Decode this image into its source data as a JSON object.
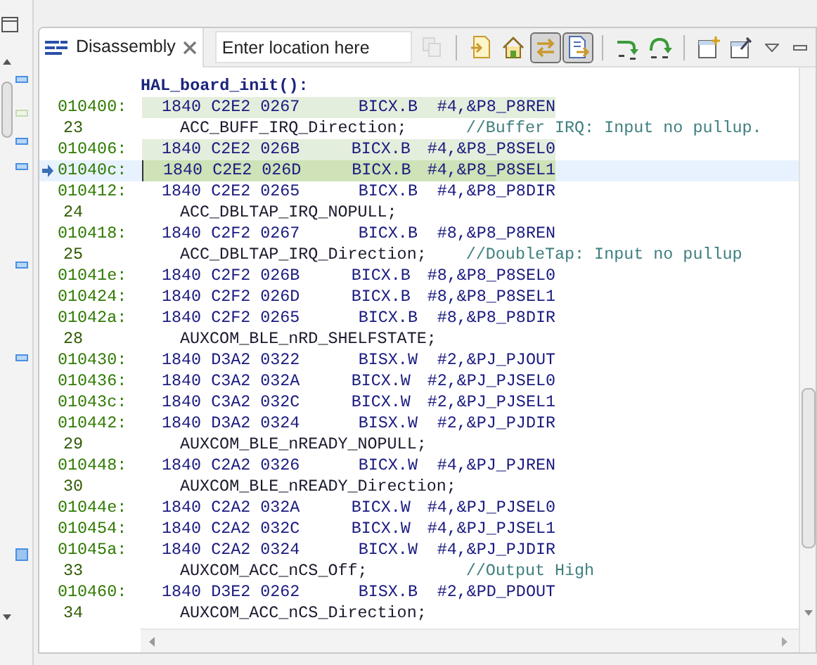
{
  "tab": {
    "label": "Disassembly",
    "selected": true
  },
  "location_field": {
    "placeholder": "Enter location here"
  },
  "toolbar": [
    {
      "kind": "go",
      "pressed": false,
      "disabled": true
    },
    {
      "kind": "separator"
    },
    {
      "kind": "pc",
      "pressed": false,
      "disabled": false
    },
    {
      "kind": "home",
      "pressed": false,
      "disabled": false
    },
    {
      "kind": "link",
      "pressed": true,
      "disabled": false
    },
    {
      "kind": "sync",
      "pressed": true,
      "disabled": false
    },
    {
      "kind": "separator"
    },
    {
      "kind": "step-into",
      "pressed": false,
      "disabled": false
    },
    {
      "kind": "step-over",
      "pressed": false,
      "disabled": false
    },
    {
      "kind": "separator"
    },
    {
      "kind": "new-view",
      "pressed": false,
      "disabled": false
    },
    {
      "kind": "pin",
      "pressed": false,
      "disabled": false
    }
  ],
  "function_label": "HAL_board_init():",
  "rows": [
    {
      "kind": "asm",
      "address": "010400:",
      "bytes": "1840 C2E2 0267",
      "mnemonic": "BICX.B",
      "operands": "#4,&P8_P8REN",
      "highlighted": true,
      "current": false
    },
    {
      "kind": "src",
      "line": "23",
      "code": "ACC_BUFF_IRQ_Direction;",
      "comment": "//Buffer IRQ:  Input no pullup."
    },
    {
      "kind": "asm",
      "address": "010406:",
      "bytes": "1840 C2E2 026B",
      "mnemonic": "BICX.B",
      "operands": "#4,&P8_P8SEL0",
      "highlighted": true,
      "current": false
    },
    {
      "kind": "asm",
      "address": "01040c:",
      "bytes": "1840 C2E2 026D",
      "mnemonic": "BICX.B",
      "operands": "#4,&P8_P8SEL1",
      "highlighted": true,
      "current": true
    },
    {
      "kind": "asm",
      "address": "010412:",
      "bytes": "1840 C2E2 0265",
      "mnemonic": "BICX.B",
      "operands": "#4,&P8_P8DIR",
      "highlighted": false,
      "current": false
    },
    {
      "kind": "src",
      "line": "24",
      "code": "ACC_DBLTAP_IRQ_NOPULL;"
    },
    {
      "kind": "asm",
      "address": "010418:",
      "bytes": "1840 C2F2 0267",
      "mnemonic": "BICX.B",
      "operands": "#8,&P8_P8REN",
      "highlighted": false,
      "current": false
    },
    {
      "kind": "src",
      "line": "25",
      "code": "ACC_DBLTAP_IRQ_Direction;",
      "comment": "//DoubleTap:  Input no pullup"
    },
    {
      "kind": "asm",
      "address": "01041e:",
      "bytes": "1840 C2F2 026B",
      "mnemonic": "BICX.B",
      "operands": "#8,&P8_P8SEL0",
      "highlighted": false,
      "current": false
    },
    {
      "kind": "asm",
      "address": "010424:",
      "bytes": "1840 C2F2 026D",
      "mnemonic": "BICX.B",
      "operands": "#8,&P8_P8SEL1",
      "highlighted": false,
      "current": false
    },
    {
      "kind": "asm",
      "address": "01042a:",
      "bytes": "1840 C2F2 0265",
      "mnemonic": "BICX.B",
      "operands": "#8,&P8_P8DIR",
      "highlighted": false,
      "current": false
    },
    {
      "kind": "src",
      "line": "28",
      "code": "AUXCOM_BLE_nRD_SHELFSTATE;"
    },
    {
      "kind": "asm",
      "address": "010430:",
      "bytes": "1840 D3A2 0322",
      "mnemonic": "BISX.W",
      "operands": "#2,&PJ_PJOUT",
      "highlighted": false,
      "current": false
    },
    {
      "kind": "asm",
      "address": "010436:",
      "bytes": "1840 C3A2 032A",
      "mnemonic": "BICX.W",
      "operands": "#2,&PJ_PJSEL0",
      "highlighted": false,
      "current": false
    },
    {
      "kind": "asm",
      "address": "01043c:",
      "bytes": "1840 C3A2 032C",
      "mnemonic": "BICX.W",
      "operands": "#2,&PJ_PJSEL1",
      "highlighted": false,
      "current": false
    },
    {
      "kind": "asm",
      "address": "010442:",
      "bytes": "1840 D3A2 0324",
      "mnemonic": "BISX.W",
      "operands": "#2,&PJ_PJDIR",
      "highlighted": false,
      "current": false
    },
    {
      "kind": "src",
      "line": "29",
      "code": "AUXCOM_BLE_nREADY_NOPULL;"
    },
    {
      "kind": "asm",
      "address": "010448:",
      "bytes": "1840 C2A2 0326",
      "mnemonic": "BICX.W",
      "operands": "#4,&PJ_PJREN",
      "highlighted": false,
      "current": false
    },
    {
      "kind": "src",
      "line": "30",
      "code": "AUXCOM_BLE_nREADY_Direction;"
    },
    {
      "kind": "asm",
      "address": "01044e:",
      "bytes": "1840 C2A2 032A",
      "mnemonic": "BICX.W",
      "operands": "#4,&PJ_PJSEL0",
      "highlighted": false,
      "current": false
    },
    {
      "kind": "asm",
      "address": "010454:",
      "bytes": "1840 C2A2 032C",
      "mnemonic": "BICX.W",
      "operands": "#4,&PJ_PJSEL1",
      "highlighted": false,
      "current": false
    },
    {
      "kind": "asm",
      "address": "01045a:",
      "bytes": "1840 C2A2 0324",
      "mnemonic": "BICX.W",
      "operands": "#4,&PJ_PJDIR",
      "highlighted": false,
      "current": false
    },
    {
      "kind": "src",
      "line": "33",
      "code": "AUXCOM_ACC_nCS_Off;",
      "comment": "//Output High"
    },
    {
      "kind": "asm",
      "address": "010460:",
      "bytes": "1840 D3E2 0262",
      "mnemonic": "BISX.B",
      "operands": "#2,&PD_PDOUT",
      "highlighted": false,
      "current": false
    },
    {
      "kind": "src",
      "line": "34",
      "code": "AUXCOM_ACC_nCS_Direction;"
    }
  ]
}
